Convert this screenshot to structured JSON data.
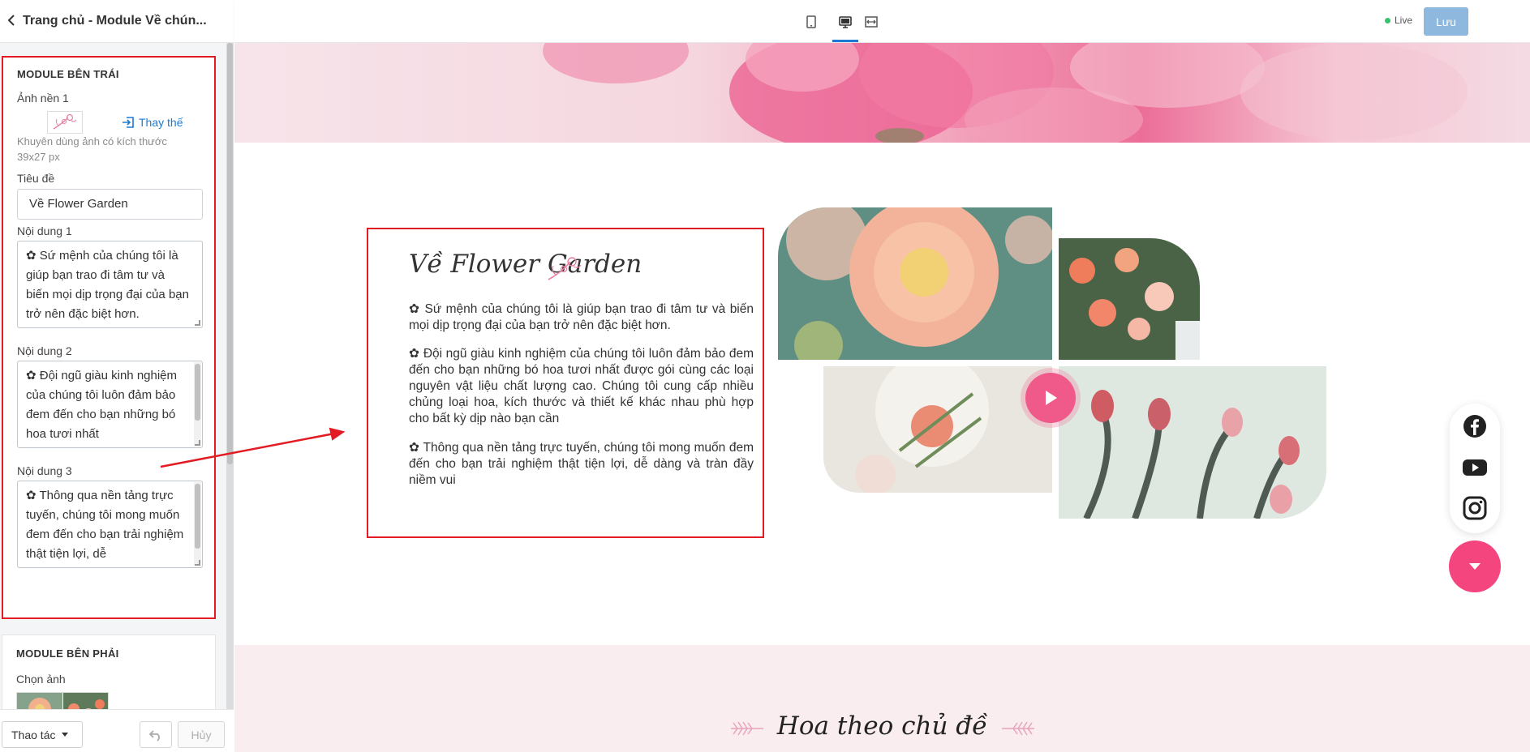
{
  "header": {
    "back_icon": "chevron-left-icon",
    "title": "Trang chủ - Module Về chún..."
  },
  "toolbar": {
    "devices": [
      "mobile-icon",
      "desktop-icon",
      "fullwidth-icon"
    ],
    "active_device": "desktop",
    "live_label": "Live",
    "save_label": "Lưu",
    "live_color": "#36c36b",
    "save_color": "#8fb8df"
  },
  "left_module": {
    "section_title": "MODULE BÊN TRÁI",
    "bg_label": "Ảnh nền 1",
    "replace_label": "Thay thế",
    "size_note": "Khuyên dùng ảnh có kích thước 39x27 px",
    "title_label": "Tiêu đề",
    "title_value": "Về Flower Garden",
    "content1_label": "Nội dung 1",
    "content1_value": "✿ Sứ mệnh của chúng tôi là giúp bạn trao đi tâm tư và biến mọi dịp trọng đại của bạn trở nên đặc biệt hơn.",
    "content2_label": "Nội dung 2",
    "content2_value": "✿ Đội ngũ giàu kinh nghiệm của chúng tôi luôn đảm bảo đem đến cho bạn những bó hoa tươi nhất",
    "content3_label": "Nội dung 3",
    "content3_value": "✿ Thông qua nền tảng trực tuyến, chúng tôi mong muốn đem đến cho bạn trải nghiệm thật tiện lợi, dễ"
  },
  "right_module": {
    "section_title": "MODULE BÊN PHẢI",
    "choose_image_label": "Chọn ảnh"
  },
  "footer": {
    "actions_label": "Thao tác",
    "cancel_label": "Hủy"
  },
  "page": {
    "about_title": "Về Flower Garden",
    "p1": "✿ Sứ mệnh của chúng tôi là giúp bạn trao đi tâm tư và biến mọi dịp trọng đại của bạn trở nên đặc biệt hơn.",
    "p2": "✿ Đội ngũ giàu kinh nghiệm của chúng tôi luôn đảm bảo đem đến cho bạn những bó hoa tươi nhất được gói cùng các loại nguyên vật liệu chất lượng cao. Chúng tôi cung cấp nhiều chủng loại hoa, kích thước và thiết kế khác nhau phù hợp cho bất kỳ dịp nào bạn cần",
    "p3": "✿ Thông qua nền tảng trực tuyến, chúng tôi mong muốn đem đến cho bạn trải nghiệm thật tiện lợi, dễ dàng và tràn đầy niềm vui",
    "category_title": "Hoa theo chủ đề",
    "social": [
      "facebook-icon",
      "youtube-icon",
      "instagram-icon"
    ],
    "accent_color": "#f5457f",
    "annotation_color": "#e31b23"
  }
}
